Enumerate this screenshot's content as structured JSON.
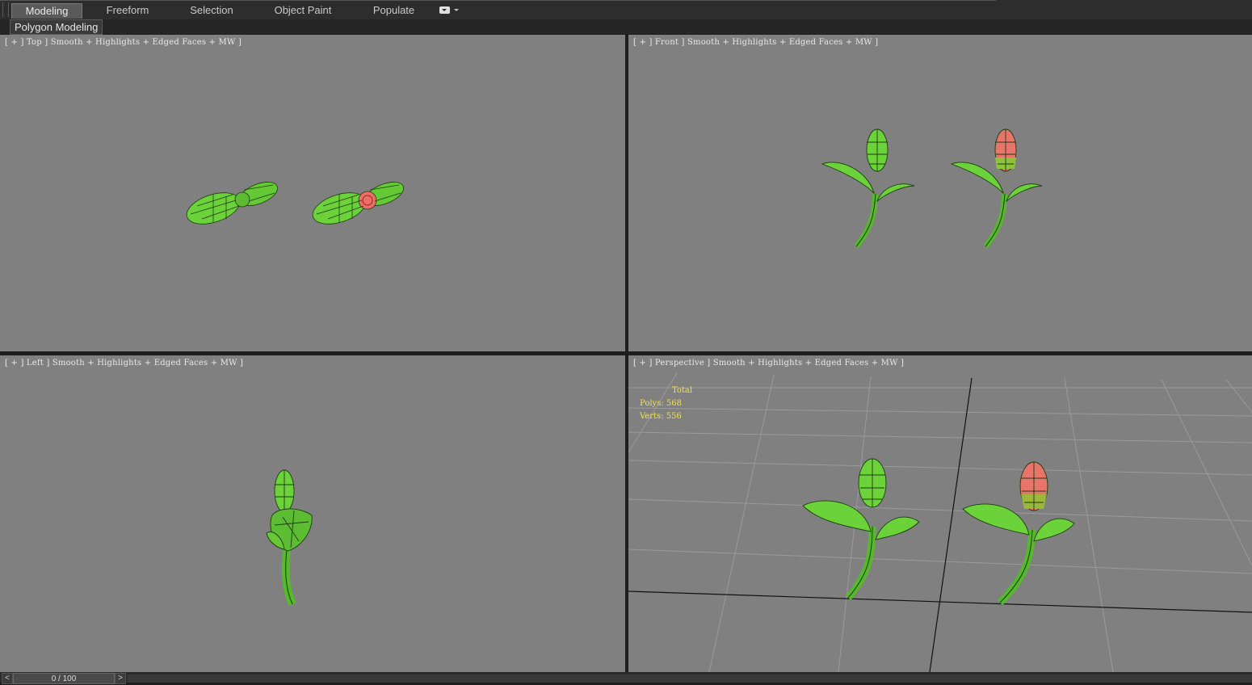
{
  "ribbon": {
    "tabs": [
      {
        "label": "Modeling",
        "active": true
      },
      {
        "label": "Freeform",
        "active": false
      },
      {
        "label": "Selection",
        "active": false
      },
      {
        "label": "Object Paint",
        "active": false
      },
      {
        "label": "Populate",
        "active": false
      }
    ],
    "panel_label": "Polygon Modeling"
  },
  "viewports": {
    "top": {
      "label": "[ + ] Top ] Smooth + Highlights + Edged Faces + MW ]"
    },
    "front": {
      "label": "[ + ] Front ] Smooth + Highlights + Edged Faces + MW ]"
    },
    "left": {
      "label": "[ + ] Left ] Smooth + Highlights + Edged Faces + MW ]"
    },
    "perspective": {
      "label": "[ + ] Perspective ] Smooth + Highlights + Edged Faces + MW ]",
      "stats": {
        "total": "Total",
        "polys": "Polys: 568",
        "verts": "Verts: 556"
      }
    }
  },
  "timeline": {
    "frame": "0 / 100",
    "prev": "<",
    "next": ">"
  },
  "colors": {
    "viewport_bg": "#808080",
    "mesh_green": "#6bd23a",
    "mesh_bud_red": "#f06c66",
    "stats_text": "#f2e34a"
  }
}
